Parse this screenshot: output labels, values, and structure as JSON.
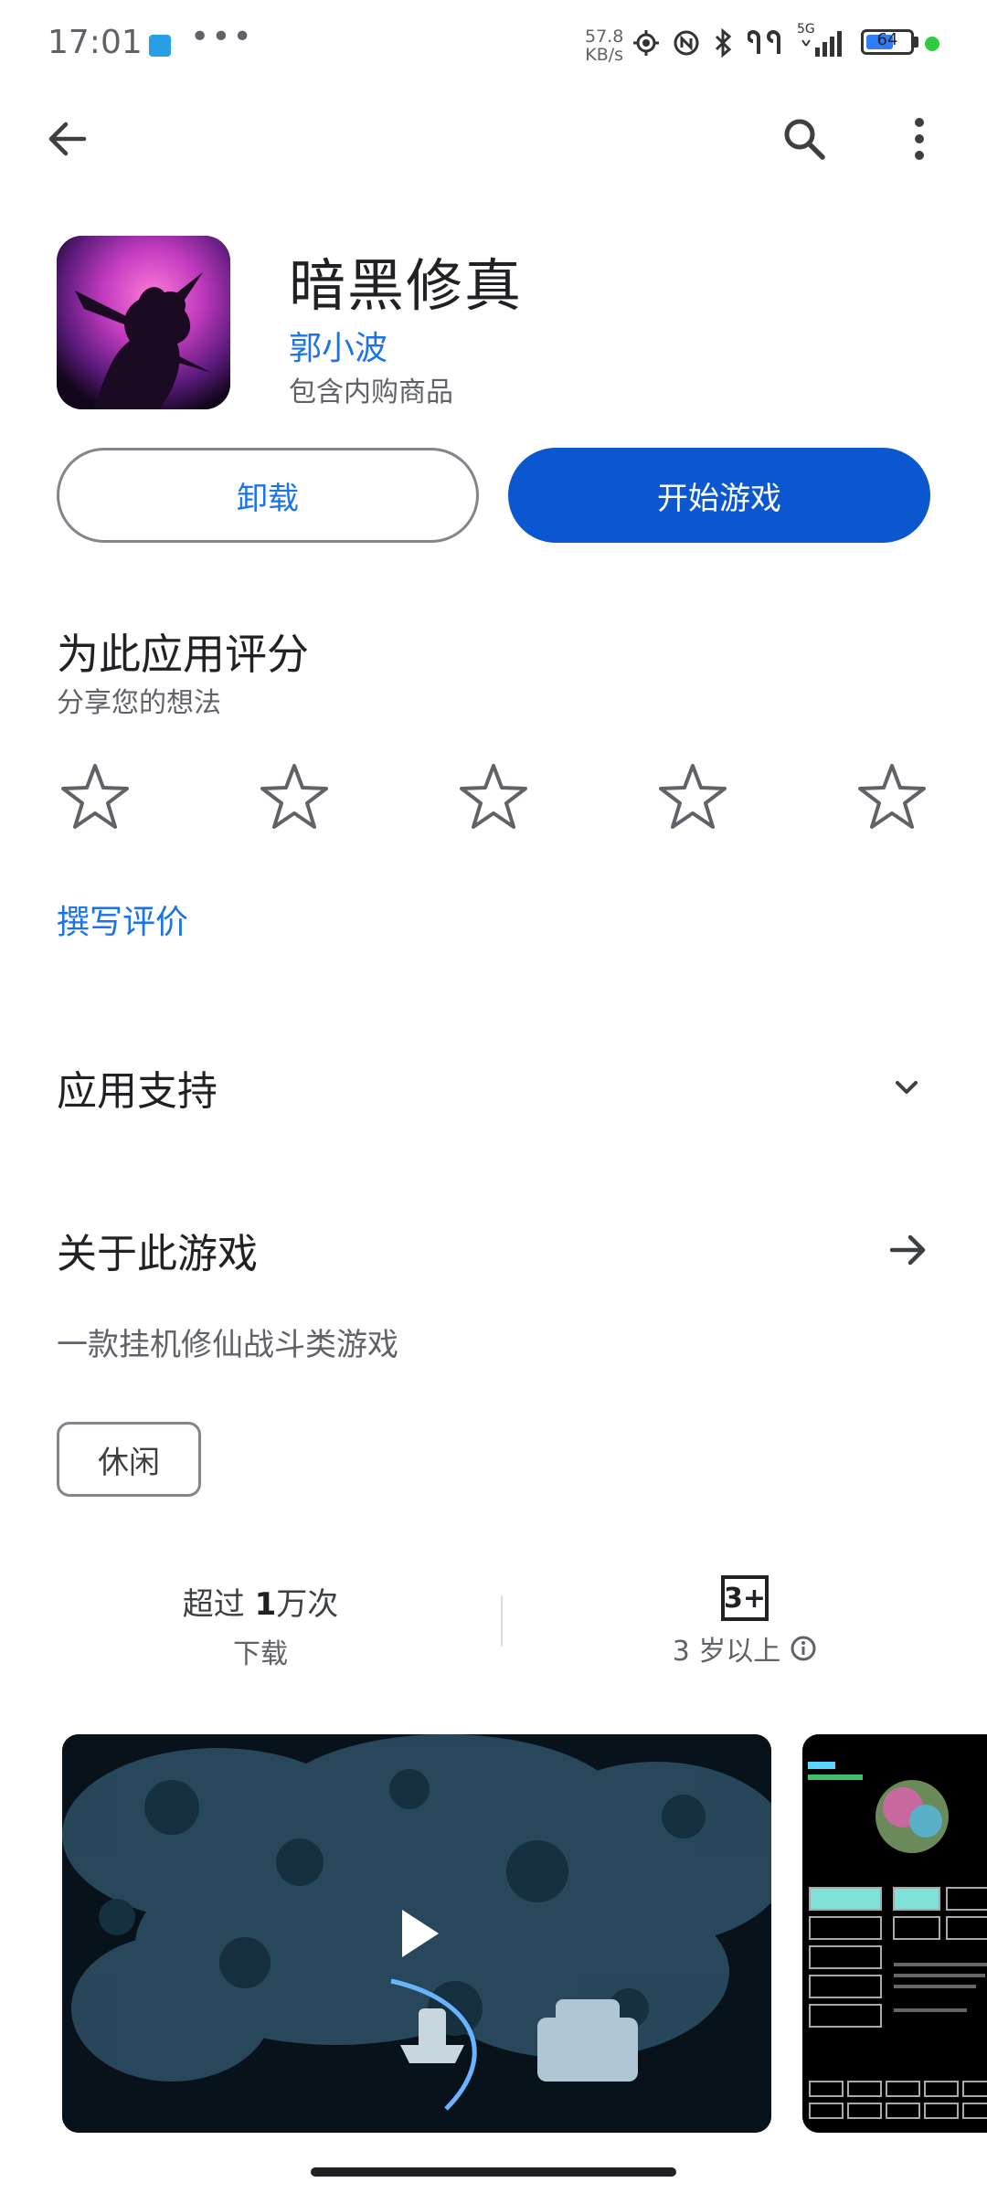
{
  "status_bar": {
    "time": "17:01",
    "more": "•••",
    "speed_value": "57.8",
    "speed_unit": "KB/s",
    "network": "5G",
    "battery": "64"
  },
  "top_bar": {
    "back_icon": "arrow-left-icon",
    "search_icon": "search-icon",
    "menu_icon": "more-vertical-icon"
  },
  "app": {
    "title": "暗黑修真",
    "developer": "郭小波",
    "iap_note": "包含内购商品",
    "uninstall_label": "卸载",
    "play_label": "开始游戏"
  },
  "rating": {
    "title": "为此应用评分",
    "subtitle": "分享您的想法",
    "stars_filled": 0,
    "stars_total": 5,
    "write_review": "撰写评价"
  },
  "support": {
    "title": "应用支持"
  },
  "about": {
    "title": "关于此游戏",
    "description": "一款挂机修仙战斗类游戏",
    "tag": "休闲"
  },
  "stats": {
    "downloads_prefix": "超过 ",
    "downloads_value": "1",
    "downloads_suffix": "万次",
    "downloads_label": "下载",
    "content_rating_badge": "3+",
    "content_rating_label": "3 岁以上"
  },
  "colors": {
    "accent": "#1a73e8",
    "primary_button": "#0b57d0",
    "status_green": "#2ecc40"
  }
}
